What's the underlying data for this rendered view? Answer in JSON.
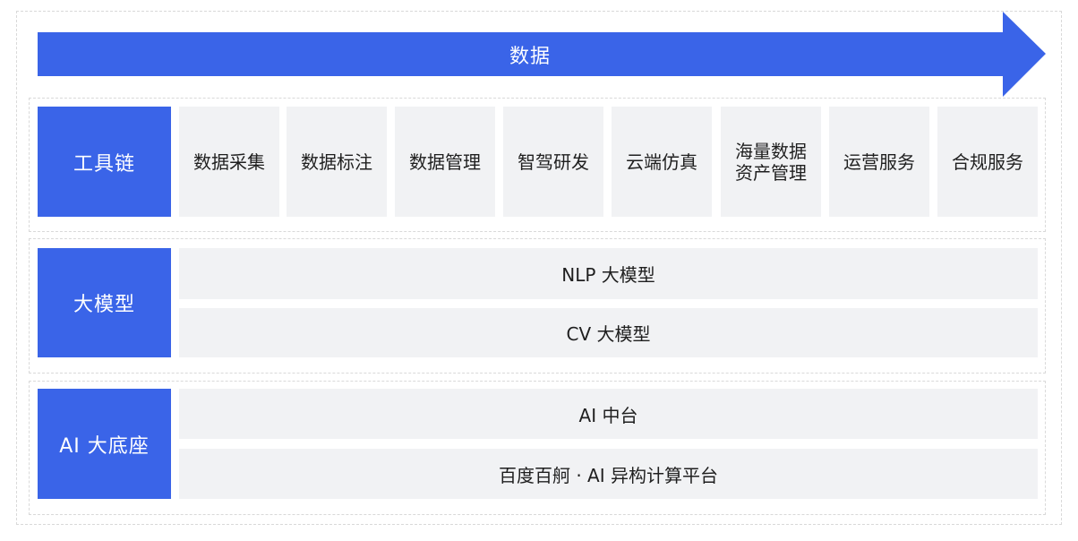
{
  "banner": {
    "label": "数据",
    "color": "#3a64e8"
  },
  "layers": {
    "tools": {
      "label": "工具链",
      "items": [
        "数据采集",
        "数据标注",
        "数据管理",
        "智驾研发",
        "云端仿真",
        "海量数据\n资产管理",
        "运营服务",
        "合规服务"
      ]
    },
    "models": {
      "label": "大模型",
      "items": [
        "NLP 大模型",
        "CV 大模型"
      ]
    },
    "base": {
      "label": "AI 大底座",
      "items": [
        "AI 中台",
        "百度百舸 · AI 异构计算平台"
      ]
    }
  },
  "colors": {
    "accent": "#3a64e8",
    "box_bg": "#f1f2f4",
    "dash": "#d9d9d9"
  }
}
